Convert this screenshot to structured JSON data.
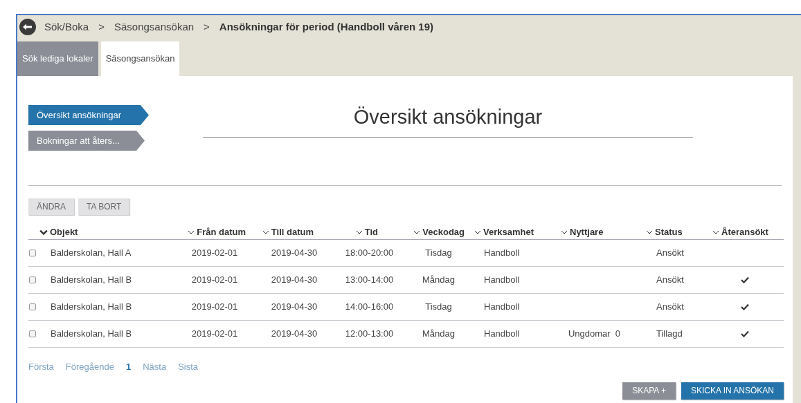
{
  "breadcrumb": [
    {
      "label": "Sök/Boka",
      "current": false
    },
    {
      "label": "Säsongsansökan",
      "current": false
    },
    {
      "label": "Ansökningar för period (Handboll våren 19)",
      "current": true
    }
  ],
  "breadcrumb_separator": ">",
  "tabs": [
    {
      "label": "Sök lediga lokaler",
      "selected": false
    },
    {
      "label": "Säsongsansökan",
      "selected": true
    }
  ],
  "steps": [
    {
      "label": "Översikt ansökningar",
      "selected": true
    },
    {
      "label": "Bokningar att åters...",
      "selected": false
    }
  ],
  "heading": "Översikt ansökningar",
  "actions": [
    "ÄNDRA",
    "TA BORT"
  ],
  "table": {
    "columns": [
      "Objekt",
      "Från datum",
      "Till datum",
      "Tid",
      "Veckodag",
      "Verksamhet",
      "Nyttjare",
      "Status",
      "Återansökt"
    ],
    "rows": [
      {
        "checked": false,
        "cells": [
          "Balderskolan, Hall A",
          "2019-02-01",
          "2019-04-30",
          "18:00-20:00",
          "Tisdag",
          "Handboll",
          "",
          "Ansökt"
        ],
        "reapplied": false
      },
      {
        "checked": false,
        "cells": [
          "Balderskolan, Hall B",
          "2019-02-01",
          "2019-04-30",
          "13:00-14:00",
          "Måndag",
          "Handboll",
          "",
          "Ansökt"
        ],
        "reapplied": true
      },
      {
        "checked": false,
        "cells": [
          "Balderskolan, Hall B",
          "2019-02-01",
          "2019-04-30",
          "14:00-16:00",
          "Tisdag",
          "Handboll",
          "",
          "Ansökt"
        ],
        "reapplied": true
      },
      {
        "checked": false,
        "cells": [
          "Balderskolan, Hall B",
          "2019-02-01",
          "2019-04-30",
          "12:00-13:00",
          "Måndag",
          "Handboll",
          "Ungdomar  0",
          "Tillagd"
        ],
        "reapplied": true
      }
    ]
  },
  "pagination": [
    {
      "label": "Första",
      "selected": false
    },
    {
      "label": "Föregående",
      "selected": false
    },
    {
      "label": "1",
      "selected": true
    },
    {
      "label": "Nästa",
      "selected": false
    },
    {
      "label": "Sista",
      "selected": false
    }
  ],
  "footer_buttons": [
    {
      "label": "SKAPA +",
      "kind": "secondary"
    },
    {
      "label": "SKICKA IN ANSÖKAN",
      "kind": "primary"
    }
  ]
}
